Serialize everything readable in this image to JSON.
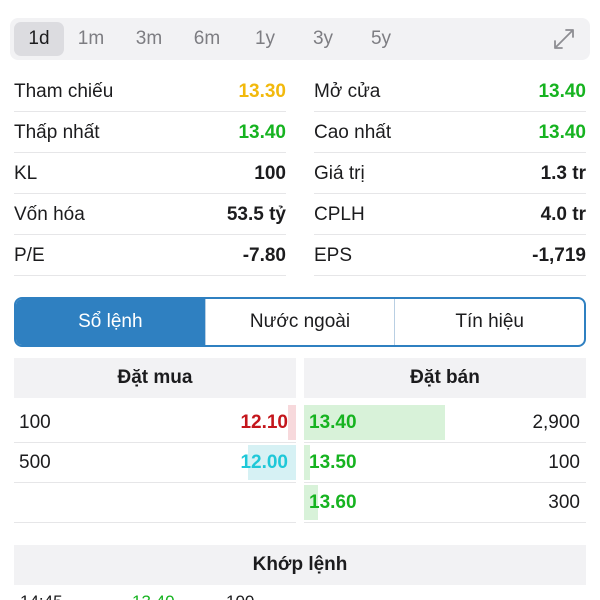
{
  "periods": [
    "1d",
    "1m",
    "3m",
    "6m",
    "1y",
    "3y",
    "5y"
  ],
  "active_period": "1d",
  "stats": {
    "left": [
      {
        "label": "Tham chiếu",
        "value": "13.30",
        "color": "#f2b90c"
      },
      {
        "label": "Thấp nhất",
        "value": "13.40",
        "color": "#16b320"
      },
      {
        "label": "KL",
        "value": "100",
        "color": "#1c1c1e"
      },
      {
        "label": "Vốn hóa",
        "value": "53.5 tỷ",
        "color": "#1c1c1e"
      },
      {
        "label": "P/E",
        "value": "-7.80",
        "color": "#1c1c1e"
      }
    ],
    "right": [
      {
        "label": "Mở cửa",
        "value": "13.40",
        "color": "#16b320"
      },
      {
        "label": "Cao nhất",
        "value": "13.40",
        "color": "#16b320"
      },
      {
        "label": "Giá trị",
        "value": "1.3 tr",
        "color": "#1c1c1e"
      },
      {
        "label": "CPLH",
        "value": "4.0 tr",
        "color": "#1c1c1e"
      },
      {
        "label": "EPS",
        "value": "-1,719",
        "color": "#1c1c1e"
      }
    ]
  },
  "tabs": [
    "Sổ lệnh",
    "Nước ngoài",
    "Tín hiệu"
  ],
  "active_tab": "Sổ lệnh",
  "order_book": {
    "buy_header": "Đặt mua",
    "sell_header": "Đặt bán",
    "buy": [
      {
        "volume": "100",
        "price": "12.10",
        "color": "#c4161c",
        "bar_fraction": 0.03
      },
      {
        "volume": "500",
        "price": "12.00",
        "color": "#1ec8d8",
        "bar_fraction": 0.17
      }
    ],
    "sell": [
      {
        "price": "13.40",
        "volume": "2,900",
        "color": "#16b320",
        "bar_fraction": 0.5
      },
      {
        "price": "13.50",
        "volume": "100",
        "color": "#16b320",
        "bar_fraction": 0.02
      },
      {
        "price": "13.60",
        "volume": "300",
        "color": "#16b320",
        "bar_fraction": 0.05
      }
    ]
  },
  "match": {
    "header": "Khớp lệnh",
    "rows": [
      {
        "time": "14:45",
        "price": "13.40",
        "volume": "100"
      }
    ]
  }
}
